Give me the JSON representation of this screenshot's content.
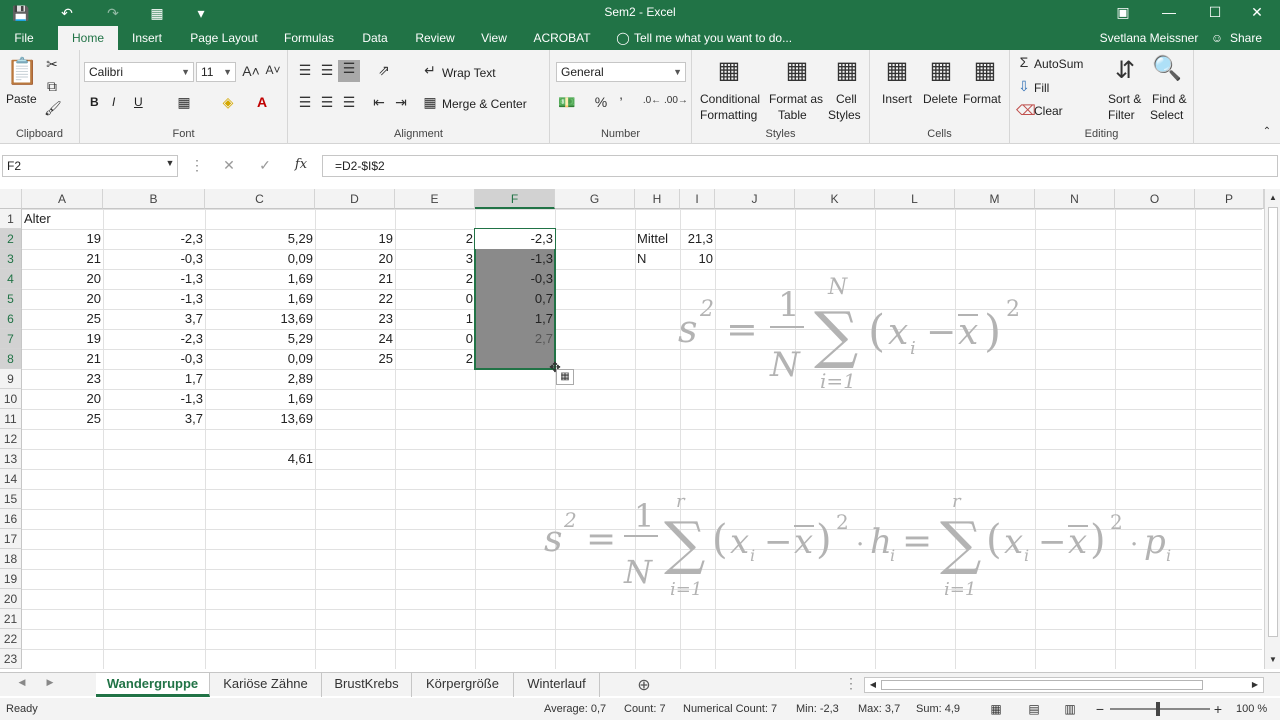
{
  "window": {
    "title": "Sem2 - Excel"
  },
  "tabs": [
    "File",
    "Home",
    "Insert",
    "Page Layout",
    "Formulas",
    "Data",
    "Review",
    "View",
    "ACROBAT"
  ],
  "tell_me": "Tell me what you want to do...",
  "user": "Svetlana Meissner",
  "share": "Share",
  "ribbon": {
    "paste": "Paste",
    "clipboard": "Clipboard",
    "font_name": "Calibri",
    "font_size": "11",
    "font": "Font",
    "bold": "B",
    "italic": "I",
    "underline": "U",
    "wrap_text": "Wrap Text",
    "merge_center": "Merge & Center",
    "alignment": "Alignment",
    "number_format": "General",
    "number": "Number",
    "conditional": "Conditional",
    "formatting": "Formatting",
    "format_as": "Format as",
    "table": "Table",
    "cell": "Cell",
    "styles_btn": "Styles",
    "styles": "Styles",
    "insert": "Insert",
    "delete": "Delete",
    "format": "Format",
    "cells": "Cells",
    "autosum": "AutoSum",
    "fill": "Fill",
    "clear": "Clear",
    "sort_filter": "Sort &",
    "filter": "Filter",
    "find_select": "Find &",
    "select": "Select",
    "editing": "Editing"
  },
  "formula_bar": {
    "name_box": "F2",
    "formula": "=D2-$I$2",
    "fx": "fx"
  },
  "columns": [
    "A",
    "B",
    "C",
    "D",
    "E",
    "F",
    "G",
    "H",
    "I",
    "J",
    "K",
    "L",
    "M",
    "N",
    "O",
    "P"
  ],
  "rows": [
    "1",
    "2",
    "3",
    "4",
    "5",
    "6",
    "7",
    "8",
    "9",
    "10",
    "11",
    "12",
    "13",
    "14",
    "15",
    "16",
    "17",
    "18",
    "19",
    "20",
    "21",
    "22",
    "23"
  ],
  "cells": {
    "A1": "Alter",
    "colA": [
      "19",
      "21",
      "20",
      "20",
      "25",
      "19",
      "21",
      "23",
      "20",
      "25"
    ],
    "colB": [
      "-2,3",
      "-0,3",
      "-1,3",
      "-1,3",
      "3,7",
      "-2,3",
      "-0,3",
      "1,7",
      "-1,3",
      "3,7"
    ],
    "colC": [
      "5,29",
      "0,09",
      "1,69",
      "1,69",
      "13,69",
      "5,29",
      "0,09",
      "2,89",
      "1,69",
      "13,69"
    ],
    "C13": "4,61",
    "colD": [
      "19",
      "20",
      "21",
      "22",
      "23",
      "24",
      "25"
    ],
    "colE": [
      "2",
      "3",
      "2",
      "0",
      "1",
      "0",
      "2"
    ],
    "colF": [
      "-2,3",
      "-1,3",
      "-0,3",
      "0,7",
      "1,7",
      "2,7",
      ""
    ],
    "H2": "Mittel",
    "I2": "21,3",
    "H3": "N",
    "I3": "10"
  },
  "sheets": [
    "Wandergruppe",
    "Kariöse Zähne",
    "BrustKrebs",
    "Körpergröße",
    "Winterlauf"
  ],
  "status": {
    "ready": "Ready",
    "average": "Average: 0,7",
    "count": "Count: 7",
    "numcount": "Numerical Count: 7",
    "min": "Min: -2,3",
    "max": "Max: 3,7",
    "sum": "Sum: 4,9",
    "zoom": "100 %"
  }
}
